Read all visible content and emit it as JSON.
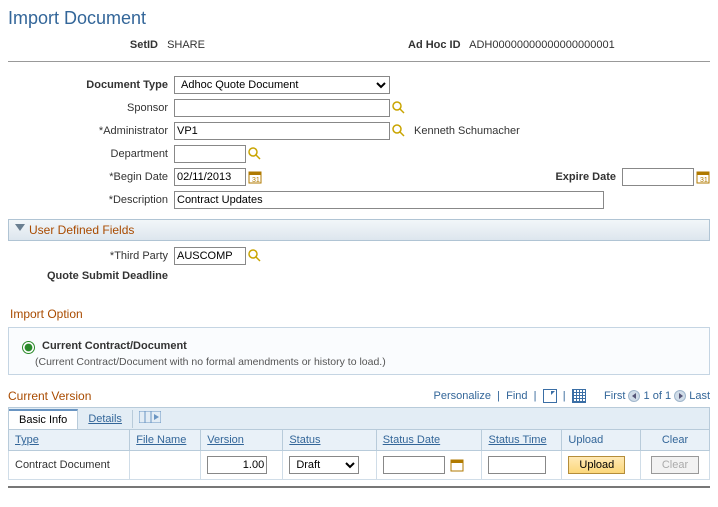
{
  "page_title": "Import Document",
  "header": {
    "setid_label": "SetID",
    "setid_value": "SHARE",
    "adhoc_label": "Ad Hoc ID",
    "adhoc_value": "ADH00000000000000000001"
  },
  "form": {
    "document_type": {
      "label": "Document Type",
      "selected": "Adhoc Quote Document"
    },
    "sponsor": {
      "label": "Sponsor",
      "value": ""
    },
    "administrator": {
      "label": "*Administrator",
      "value": "VP1",
      "name_display": "Kenneth Schumacher"
    },
    "department": {
      "label": "Department",
      "value": ""
    },
    "begin_date": {
      "label": "*Begin Date",
      "value": "02/11/2013"
    },
    "expire_date": {
      "label": "Expire Date",
      "value": ""
    },
    "description": {
      "label": "*Description",
      "value": "Contract Updates"
    }
  },
  "user_defined": {
    "title": "User Defined Fields",
    "third_party": {
      "label": "*Third Party",
      "value": "AUSCOMP"
    },
    "quote_deadline": {
      "label": "Quote Submit Deadline"
    }
  },
  "import_option": {
    "title": "Import Option",
    "radio_label": "Current Contract/Document",
    "radio_sub": "(Current Contract/Document with no formal amendments or history to load.)"
  },
  "current_version": {
    "title": "Current Version",
    "grid_links": {
      "personalize": "Personalize",
      "find": "Find"
    },
    "pager": {
      "first": "First",
      "last": "Last",
      "range": "1 of 1"
    },
    "tabs": {
      "basic_info": "Basic Info",
      "details": "Details"
    },
    "columns": {
      "type": "Type",
      "file_name": "File Name",
      "version": "Version",
      "status": "Status",
      "status_date": "Status Date",
      "status_time": "Status Time",
      "upload": "Upload",
      "clear": "Clear"
    },
    "row": {
      "type": "Contract Document",
      "file_name": "",
      "version": "1.00",
      "status": "Draft",
      "status_date": "",
      "status_time": "",
      "upload_btn": "Upload",
      "clear_btn": "Clear"
    }
  }
}
